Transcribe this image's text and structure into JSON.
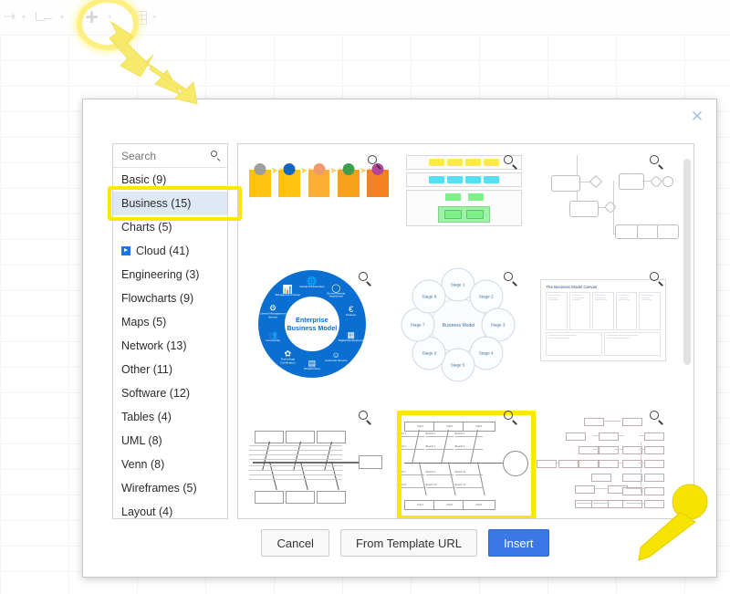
{
  "toolbar": {
    "items": [
      {
        "name": "arrow-tool",
        "glyph": "⇢"
      },
      {
        "name": "waypoint-tool",
        "glyph": ""
      },
      {
        "name": "add-tool",
        "glyph": "+"
      },
      {
        "name": "table-tool",
        "glyph": ""
      }
    ]
  },
  "dialog": {
    "close_label": "✕",
    "search": {
      "placeholder": "Search",
      "value": "",
      "icon": "search-icon"
    },
    "categories": [
      {
        "label": "Basic (9)",
        "selected": false,
        "expandable": false
      },
      {
        "label": "Business (15)",
        "selected": true,
        "expandable": false
      },
      {
        "label": "Charts (5)",
        "selected": false,
        "expandable": false
      },
      {
        "label": "Cloud (41)",
        "selected": false,
        "expandable": true
      },
      {
        "label": "Engineering (3)",
        "selected": false,
        "expandable": false
      },
      {
        "label": "Flowcharts (9)",
        "selected": false,
        "expandable": false
      },
      {
        "label": "Maps (5)",
        "selected": false,
        "expandable": false
      },
      {
        "label": "Network (13)",
        "selected": false,
        "expandable": false
      },
      {
        "label": "Other (11)",
        "selected": false,
        "expandable": false
      },
      {
        "label": "Software (12)",
        "selected": false,
        "expandable": false
      },
      {
        "label": "Tables (4)",
        "selected": false,
        "expandable": false
      },
      {
        "label": "UML (8)",
        "selected": false,
        "expandable": false
      },
      {
        "label": "Venn (8)",
        "selected": false,
        "expandable": false
      },
      {
        "label": "Wireframes (5)",
        "selected": false,
        "expandable": false
      },
      {
        "label": "Layout (4)",
        "selected": false,
        "expandable": false
      }
    ],
    "templates": [
      {
        "name": "process-chain-template",
        "kind": "process-chain",
        "selected": false
      },
      {
        "name": "color-table-template",
        "kind": "color-table",
        "selected": false
      },
      {
        "name": "bpmn-flow-template",
        "kind": "bpmn",
        "selected": false
      },
      {
        "name": "enterprise-business-model-template",
        "kind": "enterprise-circle",
        "selected": false,
        "title": "Enterprise Business Model",
        "nodes": [
          "Global Partnerships",
          "Environmental Awareness",
          "Finance",
          "Digital Development",
          "Customer Service",
          "Infrastructure",
          "Technology Certification",
          "Community",
          "Central Management Service",
          "Management Group"
        ]
      },
      {
        "name": "business-model-stages-template",
        "kind": "stage-circle",
        "selected": false,
        "center": "Business Model",
        "stages": [
          "Stage 1",
          "Stage 2",
          "Stage 3",
          "Stage 4",
          "Stage 5",
          "Stage 6",
          "Stage 7",
          "Stage 8"
        ]
      },
      {
        "name": "business-model-canvas-template",
        "kind": "canvas",
        "selected": false,
        "title": "The Business Model Canvas"
      },
      {
        "name": "fishbone-wide-template",
        "kind": "fishbone-wide",
        "selected": false
      },
      {
        "name": "fishbone-cause-effect-template",
        "kind": "fishbone-detail",
        "selected": true,
        "causes": [
          "Cell 1",
          "Cell 2",
          "Cell 3",
          "Cell 4",
          "Cell 5",
          "Cell 6"
        ],
        "branches": [
          "Branch 1",
          "Branch 2",
          "Branch 3",
          "Branch 4",
          "Branch 5",
          "Branch 6",
          "Branch 7",
          "Branch 8",
          "Branch 9",
          "Branch 10",
          "Branch 11",
          "Branch 12"
        ]
      },
      {
        "name": "network-tree-template",
        "kind": "network-tree",
        "selected": false
      }
    ],
    "footer": {
      "cancel_label": "Cancel",
      "from_url_label": "From Template URL",
      "insert_label": "Insert"
    }
  },
  "colors": {
    "accent_blue": "#3b78e7",
    "highlight_yellow": "#ffe800",
    "annotation_yellow": "#f7e96b",
    "selection_blue": "#dfe9f5",
    "ebm_blue": "#0a6fd1"
  },
  "annotations": [
    {
      "name": "toolbar-highlight-ellipse",
      "shape": "ellipse"
    },
    {
      "name": "toolbar-pointer-arrow",
      "shape": "double-arrow"
    },
    {
      "name": "insert-pointer-arrow",
      "shape": "pin-arrow"
    }
  ]
}
